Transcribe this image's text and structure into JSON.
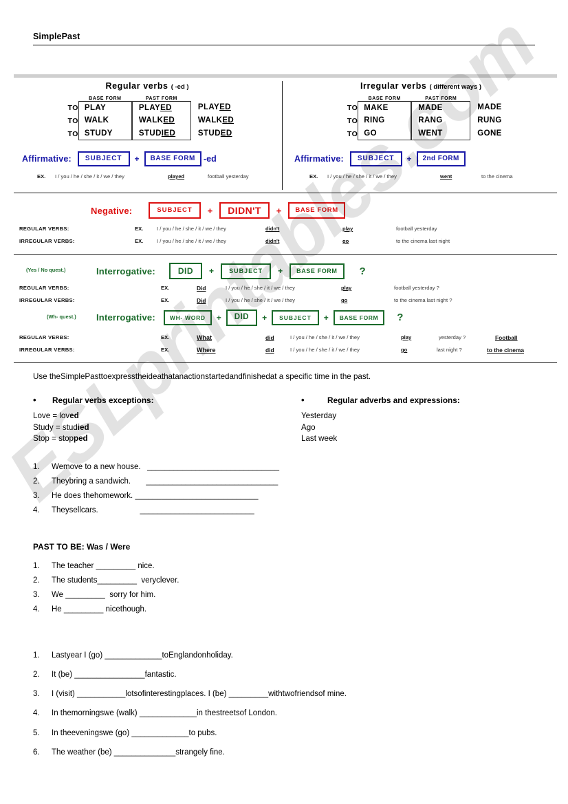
{
  "header": {
    "title": "SimplePast"
  },
  "watermark": {
    "text": "ESLprintables.com"
  },
  "grammar": {
    "regular": {
      "heading": "Regular verbs",
      "heading_note": "( -ed )",
      "col_base": "BASE FORM",
      "col_past": "PAST FORM",
      "rows": [
        {
          "to": "TO",
          "base": "PLAY",
          "past_stem": "PLAY",
          "past_suffix": "ED",
          "third_stem": "PLAY",
          "third_suffix": "ED"
        },
        {
          "to": "TO",
          "base": "WALK",
          "past_stem": "WALK",
          "past_suffix": "ED",
          "third_stem": "WALK",
          "third_suffix": "ED"
        },
        {
          "to": "TO",
          "base": "STUDY",
          "past_stem": "STUD",
          "past_suffix": "IED",
          "third_stem": "STUD",
          "third_suffix": "ED"
        }
      ],
      "formula_label": "Affirmative:",
      "formula_box1": "SUBJECT",
      "formula_plus": "+",
      "formula_box2": "BASE FORM",
      "formula_suffix": "-ed",
      "example": {
        "ex": "EX.",
        "subject": "I / you / he / she / it / we / they",
        "verb": "played",
        "rest": "football yesterday"
      }
    },
    "irregular": {
      "heading": "Irregular verbs",
      "heading_note": "( different ways )",
      "col_base": "BASE FORM",
      "col_past": "PAST FORM",
      "rows": [
        {
          "to": "TO",
          "base": "MAKE",
          "past": "MADE",
          "third": "MADE"
        },
        {
          "to": "TO",
          "base": "RING",
          "past": "RANG",
          "third": "RUNG"
        },
        {
          "to": "TO",
          "base": "GO",
          "past": "WENT",
          "third": "GONE"
        }
      ],
      "formula_label": "Affirmative:",
      "formula_box1": "SUBJECT",
      "formula_plus": "+",
      "formula_box2": "2nd FORM",
      "example": {
        "ex": "EX.",
        "subject": "I / you / he / she / it / we / they",
        "verb": "went",
        "rest": "to the cinema"
      }
    },
    "negative": {
      "label": "Negative:",
      "box1": "SUBJECT",
      "plus1": "+",
      "box2": "DIDN'T",
      "plus2": "+",
      "box3": "BASE FORM",
      "rows": [
        {
          "verb_type": "REGULAR VERBS:",
          "ex": "EX.",
          "subject": "I / you / he / she / it / we / they",
          "aux": "didn't",
          "verb": "play",
          "rest": "football yesterday"
        },
        {
          "verb_type": "IRREGULAR VERBS:",
          "ex": "EX.",
          "subject": "I / you / he / she / it / we / they",
          "aux": "didn't",
          "verb": "go",
          "rest": "to the cinema last night"
        }
      ]
    },
    "interrogative_yesno": {
      "qtype": "(Yes / No quest.)",
      "label": "Interrogative:",
      "box1": "DID",
      "plus1": "+",
      "box2": "SUBJECT",
      "plus2": "+",
      "box3": "BASE FORM",
      "qmark": "?",
      "rows": [
        {
          "verb_type": "REGULAR VERBS:",
          "ex": "EX.",
          "aux": "Did",
          "subject": "I / you / he / she / it / we / they",
          "verb": "play",
          "rest": "football yesterday  ?"
        },
        {
          "verb_type": "IRREGULAR VERBS:",
          "ex": "EX.",
          "aux": "Did",
          "subject": "I / you / he / she / it / we / they",
          "verb": "go",
          "rest": "to the cinema last night  ?"
        }
      ]
    },
    "interrogative_wh": {
      "qtype": "(Wh- quest.)",
      "label": "Interrogative:",
      "box0": "WH- WORD",
      "plus0": "+",
      "box1": "DID",
      "plus1": "+",
      "box2": "SUBJECT",
      "plus2": "+",
      "box3": "BASE FORM",
      "qmark": "?",
      "rows": [
        {
          "verb_type": "REGULAR VERBS:",
          "ex": "EX.",
          "wh": "What",
          "aux": "did",
          "subject": "I / you / he / she / it / we / they",
          "verb": "play",
          "rest": "yesterday ?",
          "answer": "Football"
        },
        {
          "verb_type": "IRREGULAR VERBS:",
          "ex": "EX.",
          "wh": "Where",
          "aux": "did",
          "subject": "I / you / he / she / it / we / they",
          "verb": "go",
          "rest": "last night ?",
          "answer": "to the cinema"
        }
      ]
    }
  },
  "usage_note": "Use theSimplePasttoexpresstheideathatanactionstartedandfinishedat a specific time in the past.",
  "exceptions": {
    "bullet": "•",
    "heading": "Regular verbs exceptions:",
    "items": [
      {
        "stem": "Love = lov",
        "bold": "ed"
      },
      {
        "stem": "Study = stud",
        "bold": "ied"
      },
      {
        "stem": "Stop = stop",
        "bold": "ped"
      }
    ]
  },
  "adverbs": {
    "bullet": "•",
    "heading": "Regular adverbs and expressions:",
    "items": [
      "Yesterday",
      "Ago",
      "Last week"
    ]
  },
  "exercise1": {
    "items": [
      {
        "num": "1.",
        "text": "Wemove to a new house.   ______________________________"
      },
      {
        "num": "2.",
        "text": "Theybring a sandwich.       ______________________________"
      },
      {
        "num": "3.",
        "text": "He does thehomework. ____________________________"
      },
      {
        "num": "4.",
        "text": "Theysellcars.                   __________________________"
      }
    ]
  },
  "exercise2": {
    "heading": "PAST TO BE: Was / Were",
    "items": [
      {
        "num": "1.",
        "text": "The teacher _________ nice."
      },
      {
        "num": "2.",
        "text": "The students_________  veryclever."
      },
      {
        "num": "3.",
        "text": "We _________  sorry for him."
      },
      {
        "num": "4.",
        "text": "He _________ nicethough."
      }
    ]
  },
  "exercise3": {
    "items": [
      {
        "num": "1.",
        "text": "Lastyear I (go) _____________toEnglandonholiday."
      },
      {
        "num": "2.",
        "text": "It (be) ________________fantastic."
      },
      {
        "num": "3.",
        "text": "I (visit) ___________lotsofinterestingplaces. I (be) _________withtwofriendsof mine."
      },
      {
        "num": "4.",
        "text": "In themorningswe (walk) _____________in thestreetsof London."
      },
      {
        "num": "5.",
        "text": "In theeveningswe (go) _____________to pubs."
      },
      {
        "num": "6.",
        "text": "The weather (be) ______________strangely fine."
      }
    ]
  },
  "colors": {
    "affirmative": "#1a1aa8",
    "negative": "#dd1111",
    "interrogative": "#1b6b2b",
    "rule": "#1b1b1b",
    "band": "#cfcfcf"
  }
}
